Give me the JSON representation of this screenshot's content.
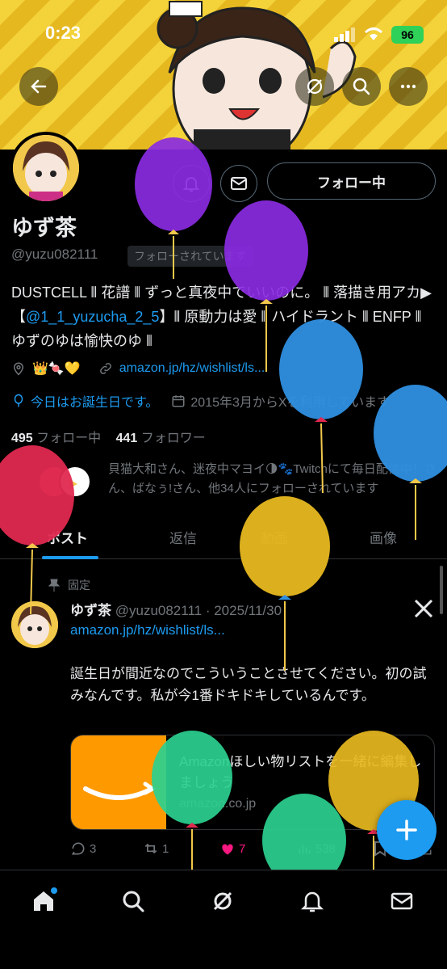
{
  "status": {
    "time": "0:23",
    "battery": "96"
  },
  "profile": {
    "name": "ゆず茶",
    "handle": "@yuzu082111",
    "follows_you": "フォローされています",
    "follow_button": "フォロー中",
    "bio_part1": "DUSTCELL ⦀ 花譜 ⦀ ずっと真夜中でいいのに。 ⦀ 落描き用アカ▶【",
    "bio_link": "@1_1_yuzucha_2_5",
    "bio_part2": "】⦀ 原動力は愛 ⦀ ハイドラント ⦀ ENFP ⦀ ゆずのゆは愉快のゆ ⦀",
    "location": "👑🍬💛",
    "website": "amazon.jp/hz/wishlist/ls...",
    "birthday": "今日はお誕生日です。",
    "joined": "2015年3月からXを利用しています",
    "following_count": "495",
    "following_label": "フォロー中",
    "followers_count": "441",
    "followers_label": "フォロワー",
    "followed_by": "貝猫大和さん、迷夜中マヨイ🌗🐾Twitchにて毎日配信中！さん、ばなぅ!さん、他34人にフォローされています"
  },
  "tabs": [
    {
      "label": "ポスト"
    },
    {
      "label": "返信"
    },
    {
      "label": "動画"
    },
    {
      "label": "画像"
    }
  ],
  "post": {
    "pinned_label": "固定",
    "author": "ゆず茶",
    "meta": "@yuzu082111 · 2025/11/30",
    "link": "amazon.jp/hz/wishlist/ls...",
    "text": "誕生日が間近なのでこういうことさせてください。初の試みなんです。私が今1番ドキドキしているんです。",
    "card_title": "Amazonほしい物リストを一緒に編集しましょう",
    "card_domain": "amazon.co.jp",
    "replies": "3",
    "reposts": "1",
    "likes": "7",
    "views": "538"
  },
  "colors": {
    "accent": "#1d9bf0",
    "like": "#f91880",
    "banner_yellow": "#f3d23a",
    "balloon_purple": "#8a2be2",
    "balloon_blue": "#2f8fe0",
    "balloon_red": "#e0294f",
    "balloon_gold": "#e8b820",
    "balloon_green": "#2bd08f"
  },
  "icons": [
    "back-arrow-icon",
    "grok-icon",
    "search-icon",
    "more-icon",
    "bell-plus-icon",
    "mail-icon",
    "location-icon",
    "link-icon",
    "balloon-icon",
    "calendar-icon",
    "pin-icon",
    "x-logo-icon",
    "reply-icon",
    "repost-icon",
    "heart-icon",
    "views-icon",
    "home-icon",
    "notifications-icon",
    "messages-icon",
    "plus-icon"
  ]
}
